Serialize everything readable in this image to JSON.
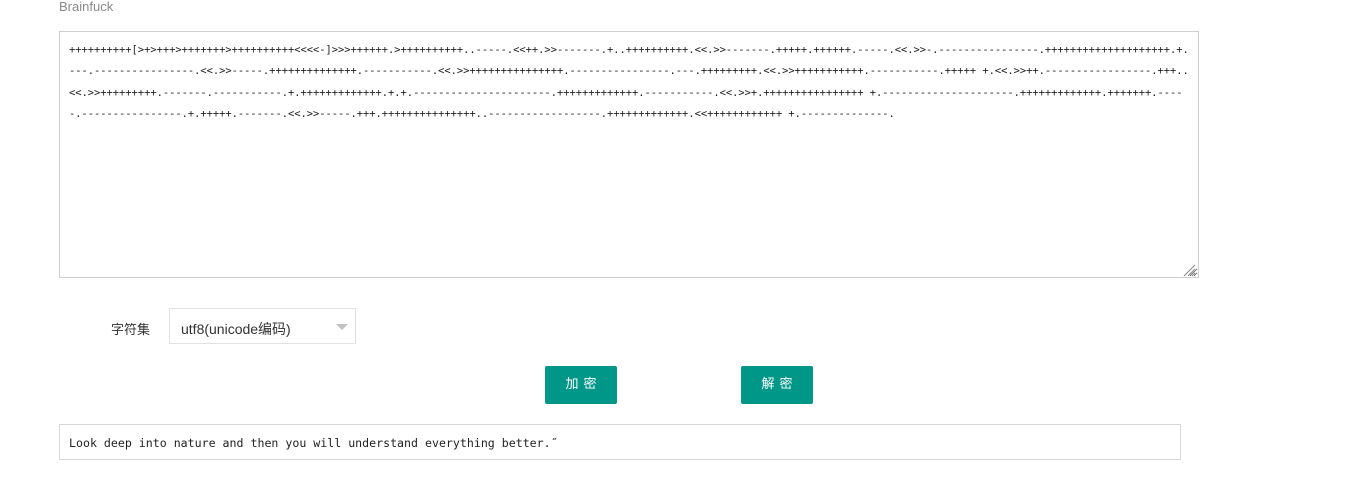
{
  "section": {
    "title": "Brainfuck"
  },
  "input": {
    "code": "++++++++++[>+>+++>+++++++>++++++++++<<<<-]>>>++++++.>++++++++++..-----.<<++.>>-------.+..++++++++++.<<.>>-------.+++++.++++++.-----.<<.>>-.----------------.++++++++++++++++++++.+.---.----------------.<<.>>-----.++++++++++++++.-----------.<<.>>+++++++++++++++.----------------.---.+++++++++.<<.>>+++++++++++.-----------.+++++ +.<<.>>++.-----------------.+++..<<.>>+++++++++.-------.-----------.+.+++++++++++++.+.+.----------------------.+++++++++++++.-----------.<<.>>+.++++++++++++++++ +.---------------------.+++++++++++++.+++++++.-----.----------------.+.+++++.-------.<<.>>-----.+++.+++++++++++++++..------------------.+++++++++++++.<<++++++++++++ +.--------------."
  },
  "charset": {
    "label": "字符集",
    "selected": "utf8(unicode编码)"
  },
  "buttons": {
    "encrypt_label": "加密",
    "decrypt_label": "解密"
  },
  "output": {
    "text": "Look deep into nature and then you will understand everything better.˝"
  },
  "colors": {
    "accent": "#009688",
    "border": "#cfcfcf",
    "title_text": "#8a8a8a"
  },
  "icons": {
    "select_arrow": "chevron-down-icon",
    "textarea_grip": "resize-grip-icon"
  }
}
